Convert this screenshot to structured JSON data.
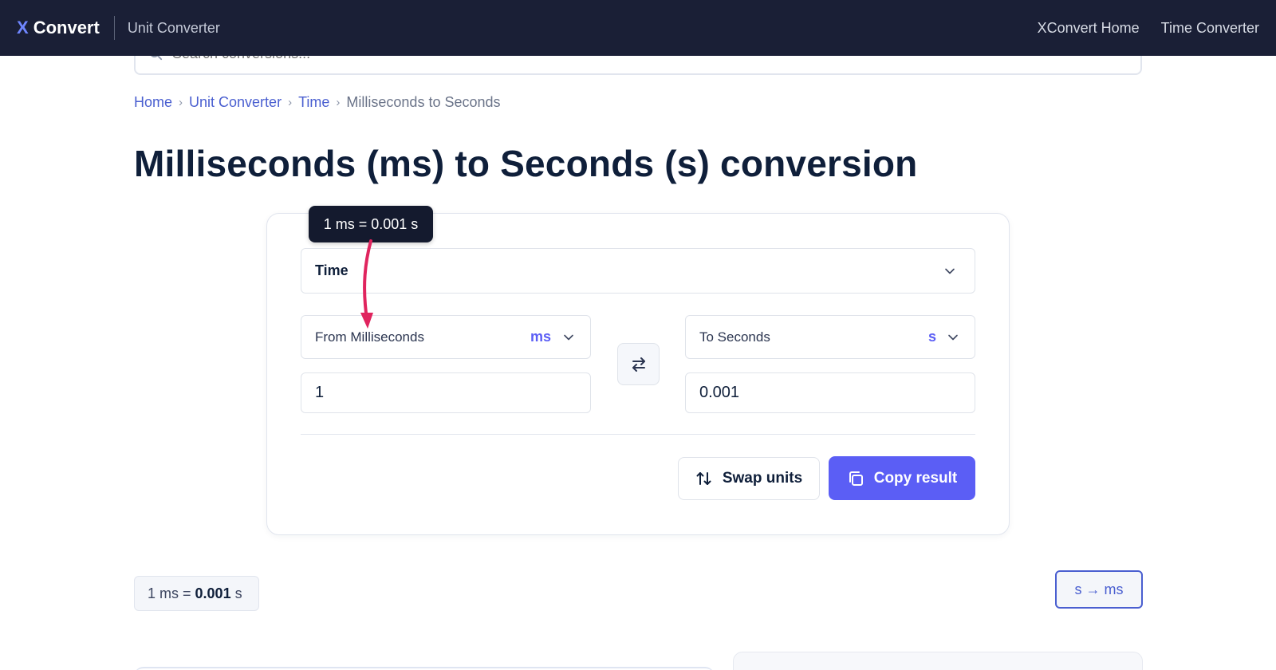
{
  "nav": {
    "brand_x": "X",
    "brand_name": "Convert",
    "section": "Unit Converter",
    "links": [
      "XConvert Home",
      "Time Converter"
    ]
  },
  "search": {
    "placeholder": "Search conversions..."
  },
  "breadcrumb": {
    "items": [
      "Home",
      "Unit Converter",
      "Time"
    ],
    "current": "Milliseconds to Seconds"
  },
  "page_title": "Milliseconds (ms) to Seconds (s) conversion",
  "tooltip": {
    "text": "1 ms = 0.001 s"
  },
  "converter": {
    "category": "Time",
    "from": {
      "label": "From Milliseconds",
      "abbr": "ms",
      "value": "1"
    },
    "to": {
      "label": "To Seconds",
      "abbr": "s",
      "value": "0.001"
    },
    "swap_label": "Swap units",
    "copy_label": "Copy result"
  },
  "result": {
    "prefix": "1 ms =",
    "value": "0.001",
    "suffix": "s"
  },
  "reverse_link": "s → ms",
  "colors": {
    "accent": "#5b5ef5",
    "nav_bg": "#1a1f36",
    "link": "#4a5fd0",
    "callout_arrow": "#e0245e"
  }
}
